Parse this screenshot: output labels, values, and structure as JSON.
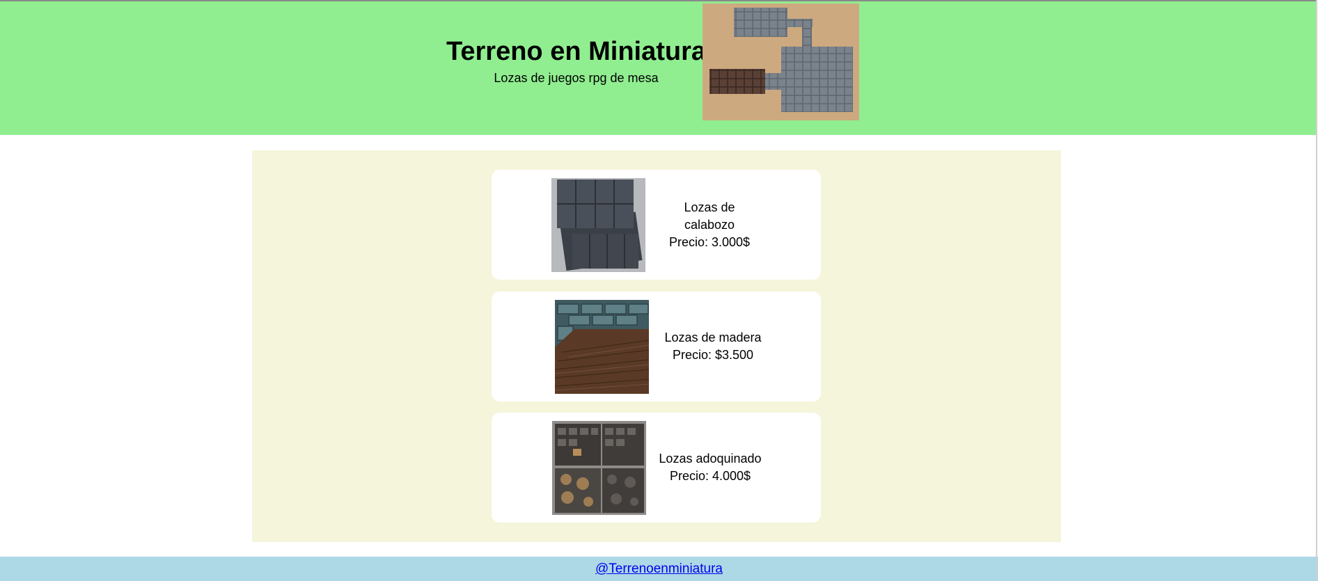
{
  "header": {
    "title": "Terreno en Miniatura",
    "subtitle": "Lozas de juegos rpg de mesa",
    "background_color": "#90ee90"
  },
  "main": {
    "background_color": "#f5f5dc",
    "products": [
      {
        "name": "Lozas de calabozo",
        "price": "Precio: 3.000$"
      },
      {
        "name": "Lozas de madera",
        "price": "Precio: $3.500"
      },
      {
        "name": "Lozas adoquinado",
        "price": "Precio: 4.000$"
      }
    ]
  },
  "footer": {
    "link_text": "@Terrenoenminiatura",
    "background_color": "#add8e6"
  }
}
